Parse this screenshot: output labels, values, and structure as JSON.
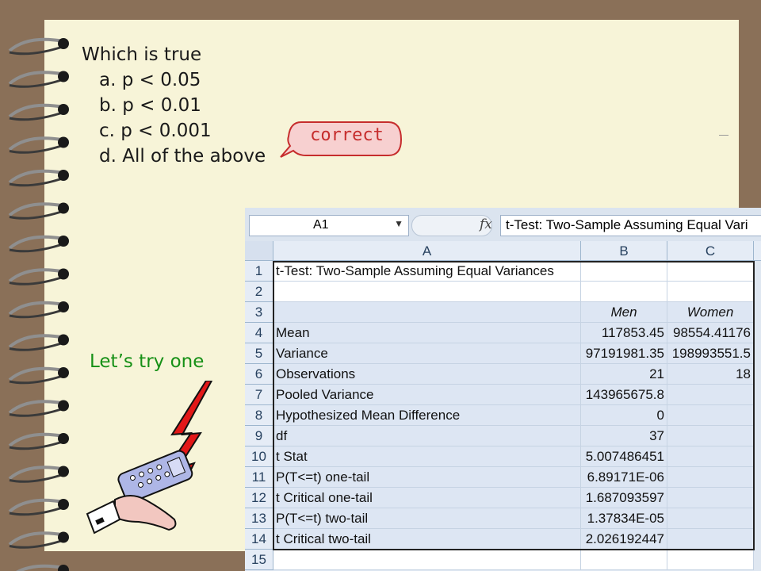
{
  "question": {
    "title": "Which is true",
    "options": [
      "a. p < 0.05",
      "b. p < 0.01",
      "c. p < 0.001",
      "d. All of the above"
    ]
  },
  "feedback_bubble": "correct",
  "prompt_label": "Let’s try one",
  "colors": {
    "background": "#8a7058",
    "paper": "#f7f4d8",
    "correct": "#c62d2d",
    "prompt": "#169016"
  },
  "spreadsheet": {
    "name_box": "A1",
    "formula": "t-Test: Two-Sample Assuming Equal Vari",
    "columns": [
      "A",
      "B",
      "C"
    ],
    "rows": [
      {
        "n": "1",
        "a": "t-Test: Two-Sample Assuming Equal Variances",
        "b": "",
        "c": ""
      },
      {
        "n": "2",
        "a": "",
        "b": "",
        "c": ""
      },
      {
        "n": "3",
        "a": "",
        "b": "Men",
        "c": "Women"
      },
      {
        "n": "4",
        "a": "Mean",
        "b": "117853.45",
        "c": "98554.41176"
      },
      {
        "n": "5",
        "a": "Variance",
        "b": "97191981.35",
        "c": "198993551.5"
      },
      {
        "n": "6",
        "a": "Observations",
        "b": "21",
        "c": "18"
      },
      {
        "n": "7",
        "a": "Pooled Variance",
        "b": "143965675.8",
        "c": ""
      },
      {
        "n": "8",
        "a": "Hypothesized Mean Difference",
        "b": "0",
        "c": ""
      },
      {
        "n": "9",
        "a": "df",
        "b": "37",
        "c": ""
      },
      {
        "n": "10",
        "a": "t Stat",
        "b": "5.007486451",
        "c": ""
      },
      {
        "n": "11",
        "a": "P(T<=t) one-tail",
        "b": "6.89171E-06",
        "c": ""
      },
      {
        "n": "12",
        "a": "t Critical one-tail",
        "b": "1.687093597",
        "c": ""
      },
      {
        "n": "13",
        "a": "P(T<=t) two-tail",
        "b": "1.37834E-05",
        "c": ""
      },
      {
        "n": "14",
        "a": "t Critical two-tail",
        "b": "2.026192447",
        "c": ""
      },
      {
        "n": "15",
        "a": "",
        "b": "",
        "c": ""
      }
    ]
  }
}
